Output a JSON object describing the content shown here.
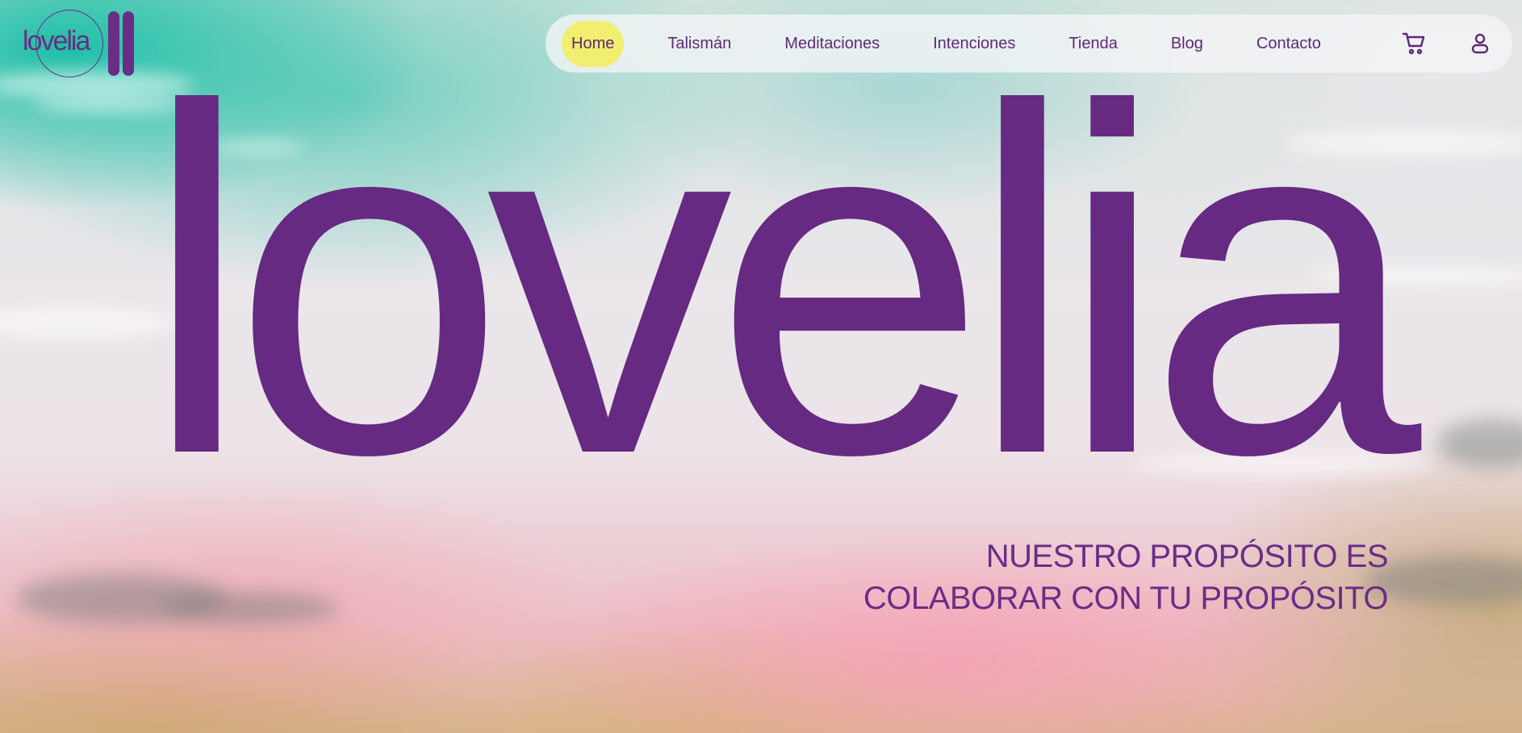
{
  "brand": {
    "logo_text": "lovelia",
    "hero_text": "lovelia",
    "color": "#662a82"
  },
  "nav": {
    "items": [
      {
        "label": "Home",
        "active": true
      },
      {
        "label": "Talismán",
        "active": false
      },
      {
        "label": "Meditaciones",
        "active": false
      },
      {
        "label": "Intenciones",
        "active": false
      },
      {
        "label": "Tienda",
        "active": false
      },
      {
        "label": "Blog",
        "active": false
      },
      {
        "label": "Contacto",
        "active": false
      }
    ],
    "active_highlight": "#f1ee70",
    "icons": [
      "cart-icon",
      "user-icon"
    ]
  },
  "tagline": {
    "line1": "NUESTRO PROPÓSITO ES",
    "line2": "COLABORAR CON TU PROPÓSITO"
  }
}
